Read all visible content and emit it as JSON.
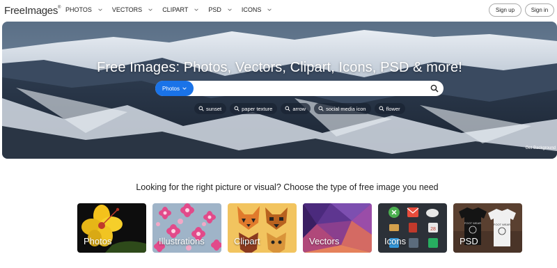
{
  "header": {
    "logo": "FreeImages",
    "logo_mark": "®",
    "nav": [
      {
        "label": "PHOTOS"
      },
      {
        "label": "VECTORS"
      },
      {
        "label": "CLIPART"
      },
      {
        "label": "PSD"
      },
      {
        "label": "ICONS"
      }
    ],
    "signup_label": "Sign up",
    "signin_label": "Sign in"
  },
  "hero": {
    "title": "Free Images: Photos, Vectors, Clipart, Icons, PSD & more!",
    "search": {
      "type_label": "Photos",
      "placeholder": "",
      "value": ""
    },
    "tags": [
      {
        "label": "sunset"
      },
      {
        "label": "paper texture"
      },
      {
        "label": "arrow"
      },
      {
        "label": "social media icon"
      },
      {
        "label": "flower"
      }
    ],
    "credit": "Get Background"
  },
  "types": {
    "heading": "Looking for the right picture or visual? Choose the type of free image you need",
    "cards": [
      {
        "label": "Photos"
      },
      {
        "label": "Illustrations"
      },
      {
        "label": "Clipart"
      },
      {
        "label": "Vectors"
      },
      {
        "label": "Icons"
      },
      {
        "label": "PSD"
      }
    ]
  },
  "colors": {
    "accent": "#1a73e8",
    "tag_bg": "#19232f"
  }
}
